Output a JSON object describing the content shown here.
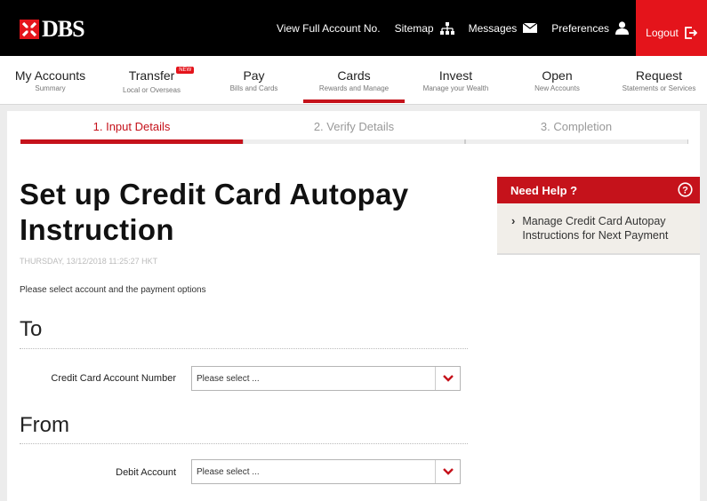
{
  "brand": {
    "name": "DBS",
    "accent": "#e4141b",
    "dark_red": "#c5121b"
  },
  "toplinks": [
    {
      "label": "View Full Account No.",
      "icon": ""
    },
    {
      "label": "Sitemap",
      "icon": "sitemap-icon"
    },
    {
      "label": "Messages",
      "icon": "envelope-icon"
    },
    {
      "label": "Preferences",
      "icon": "user-icon"
    },
    {
      "label": "Logout",
      "icon": "logout-icon"
    }
  ],
  "nav": [
    {
      "label": "My Accounts",
      "sub": "Summary"
    },
    {
      "label": "Transfer",
      "sub": "Local or Overseas",
      "badge": "NEW"
    },
    {
      "label": "Pay",
      "sub": "Bills and Cards"
    },
    {
      "label": "Cards",
      "sub": "Rewards and Manage",
      "active": true
    },
    {
      "label": "Invest",
      "sub": "Manage your Wealth"
    },
    {
      "label": "Open",
      "sub": "New Accounts"
    },
    {
      "label": "Request",
      "sub": "Statements or Services"
    }
  ],
  "steps": [
    "1. Input Details",
    "2. Verify Details",
    "3. Completion"
  ],
  "page": {
    "title": "Set up Credit Card Autopay Instruction",
    "timestamp": "THURSDAY, 13/12/2018 11:25:27 HKT",
    "instruction": "Please select account and the payment options"
  },
  "form": {
    "to_heading": "To",
    "from_heading": "From",
    "credit_card_label": "Credit Card Account Number",
    "credit_card_value": "Please select ...",
    "debit_label": "Debit Account",
    "debit_value": "Please select ..."
  },
  "help": {
    "title": "Need Help ?",
    "link": "Manage Credit Card Autopay Instructions for Next Payment"
  }
}
